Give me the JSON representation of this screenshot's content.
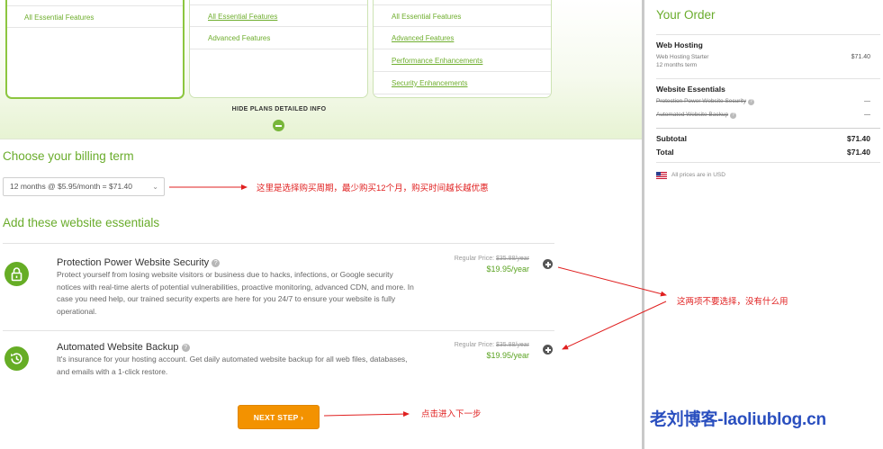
{
  "plans": [
    {
      "features": [
        "All Essential Features"
      ]
    },
    {
      "features": [
        "All Essential Features",
        "Advanced Features"
      ]
    },
    {
      "features": [
        "All Essential Features",
        "Advanced Features",
        "Performance Enhancements",
        "Security Enhancements"
      ]
    }
  ],
  "hide_plans_label": "HIDE PLANS DETAILED INFO",
  "billing": {
    "title": "Choose your billing term",
    "selected": "12 months @ $5.95/month = $71.40"
  },
  "essentials": {
    "title": "Add these website essentials",
    "items": [
      {
        "name": "Protection Power Website Security",
        "description": "Protect yourself from losing website visitors or business due to hacks, infections, or Google security notices with real-time alerts of potential vulnerabilities, proactive monitoring, advanced CDN, and more. In case you need help, our trained security experts are here for you 24/7 to ensure your website is fully operational.",
        "regular_label": "Regular Price:",
        "regular_price": "$35.88/year",
        "price": "$19.95/year"
      },
      {
        "name": "Automated Website Backup",
        "description": "It's insurance for your hosting account. Get daily automated website backup for all web files, databases, and emails with a 1-click restore.",
        "regular_label": "Regular Price:",
        "regular_price": "$35.88/year",
        "price": "$19.95/year"
      }
    ]
  },
  "next_step_label": "NEXT STEP ›",
  "annotations": {
    "billing": "这里是选择购买周期，最少购买12个月，购买时间越长越优惠",
    "essentials": "这两项不要选择，没有什么用",
    "next": "点击进入下一步"
  },
  "order": {
    "title": "Your Order",
    "hosting_header": "Web Hosting",
    "hosting_plan": "Web Hosting Starter",
    "hosting_term": "12 months term",
    "hosting_price": "$71.40",
    "essentials_header": "Website Essentials",
    "essential_1": "Protection Power Website Security",
    "essential_1_value": "—",
    "essential_2": "Automated Website Backup",
    "essential_2_value": "—",
    "subtotal_label": "Subtotal",
    "subtotal_value": "$71.40",
    "total_label": "Total",
    "total_value": "$71.40",
    "currency_note": "All prices are in USD"
  },
  "watermark": "老刘博客-laoliublog.cn",
  "colors": {
    "accent_green": "#6aac2c",
    "button_orange": "#f39200",
    "annotation_red": "#e02020",
    "watermark_blue": "#2a4fbf"
  }
}
